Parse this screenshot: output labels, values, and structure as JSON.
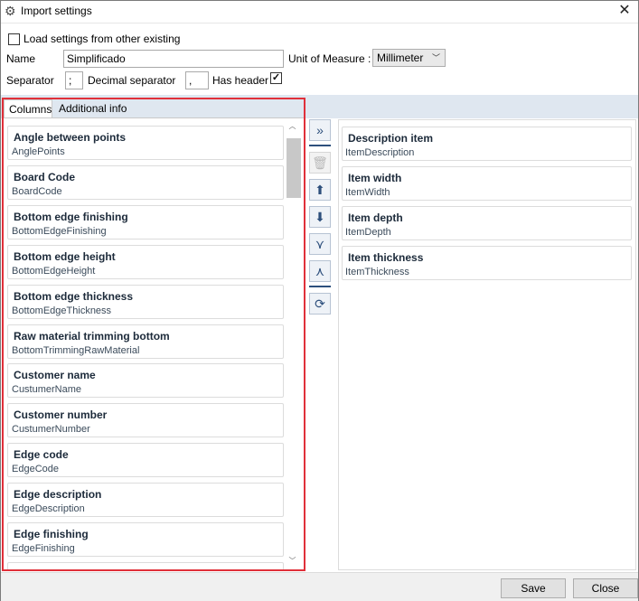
{
  "window": {
    "title": "Import settings",
    "close_glyph": "✕",
    "icon": "gear-icon"
  },
  "form": {
    "load_label": "Load settings from other existing",
    "load_checked": false,
    "name_label": "Name",
    "name_value": "Simplificado",
    "uom_label": "Unit of Measure :",
    "uom_value": "Millimeter",
    "separator_label": "Separator",
    "separator_value": ";",
    "decimal_label": "Decimal separator",
    "decimal_value": ",",
    "header_label": "Has header",
    "header_checked": true
  },
  "tabs": [
    {
      "label": "Columns",
      "active": true
    },
    {
      "label": "Additional info",
      "active": false
    }
  ],
  "columns": [
    {
      "title": "Angle between points",
      "sub": "AnglePoints"
    },
    {
      "title": "Board Code",
      "sub": "BoardCode"
    },
    {
      "title": "Bottom edge finishing",
      "sub": "BottomEdgeFinishing"
    },
    {
      "title": "Bottom edge height",
      "sub": "BottomEdgeHeight"
    },
    {
      "title": "Bottom edge thickness",
      "sub": "BottomEdgeThickness"
    },
    {
      "title": "Raw material trimming bottom",
      "sub": "BottomTrimmingRawMaterial"
    },
    {
      "title": "Customer name",
      "sub": "CustumerName"
    },
    {
      "title": "Customer number",
      "sub": "CustumerNumber"
    },
    {
      "title": "Edge code",
      "sub": "EdgeCode"
    },
    {
      "title": "Edge description",
      "sub": "EdgeDescription"
    },
    {
      "title": "Edge finishing",
      "sub": "EdgeFinishing"
    }
  ],
  "selected": [
    {
      "title": "Description item",
      "sub": "ItemDescription"
    },
    {
      "title": "Item width",
      "sub": "ItemWidth"
    },
    {
      "title": "Item depth",
      "sub": "ItemDepth"
    },
    {
      "title": "Item thickness",
      "sub": "ItemThickness"
    }
  ],
  "toolbar": {
    "add_all": "»",
    "delete": "🗑",
    "up": "⬆",
    "down": "⬇",
    "merge": "⋎",
    "split": "⋏",
    "refresh": "⟳"
  },
  "footer": {
    "save_label": "Save",
    "close_label": "Close"
  }
}
